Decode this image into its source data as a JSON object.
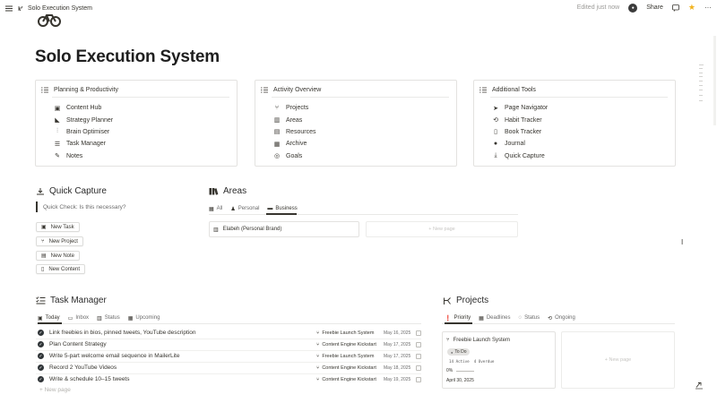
{
  "topbar": {
    "breadcrumb": "Solo Execution System",
    "edited": "Edited just now",
    "share": "Share"
  },
  "page": {
    "title": "Solo Execution System"
  },
  "cards": [
    {
      "title": "Planning & Productivity",
      "items": [
        {
          "label": "Content Hub",
          "icon": "inbox-icon"
        },
        {
          "label": "Strategy Planner",
          "icon": "megaphone-icon"
        },
        {
          "label": "Brain Optimiser",
          "icon": "sliders-icon"
        },
        {
          "label": "Task Manager",
          "icon": "checklist-icon"
        },
        {
          "label": "Notes",
          "icon": "pen-icon"
        }
      ]
    },
    {
      "title": "Activity Overview",
      "items": [
        {
          "label": "Projects",
          "icon": "branch-icon"
        },
        {
          "label": "Areas",
          "icon": "books-icon"
        },
        {
          "label": "Resources",
          "icon": "library-icon"
        },
        {
          "label": "Archive",
          "icon": "archive-icon"
        },
        {
          "label": "Goals",
          "icon": "target-icon"
        }
      ]
    },
    {
      "title": "Additional Tools",
      "items": [
        {
          "label": "Page Navigator",
          "icon": "cursor-icon"
        },
        {
          "label": "Habit Tracker",
          "icon": "repeat-icon"
        },
        {
          "label": "Book Tracker",
          "icon": "book-icon"
        },
        {
          "label": "Journal",
          "icon": "brain-icon"
        },
        {
          "label": "Quick Capture",
          "icon": "download-icon"
        }
      ]
    }
  ],
  "quick_capture": {
    "title": "Quick Capture",
    "check": "Quick Check: Is this necessary?",
    "buttons": [
      "New Task",
      "New Project",
      "New Note",
      "New Content"
    ]
  },
  "areas": {
    "title": "Areas",
    "tabs": [
      "All",
      "Personal",
      "Business"
    ],
    "active_tab": "Business",
    "cards": [
      "Elabeh (Personal Brand)"
    ],
    "new_page": "+ New page"
  },
  "task_manager": {
    "title": "Task Manager",
    "tabs": [
      "Today",
      "Inbox",
      "Status",
      "Upcoming"
    ],
    "active_tab": "Today",
    "tasks": [
      {
        "name": "Link freebies in bios, pinned tweets, YouTube description",
        "project": "Freebie Launch System",
        "date": "May 16, 2025"
      },
      {
        "name": "Plan Content Strategy",
        "project": "Content Engine Kickstart",
        "date": "May 17, 2025"
      },
      {
        "name": "Write 5-part welcome email sequence in MailerLite",
        "project": "Freebie Launch System",
        "date": "May 17, 2025"
      },
      {
        "name": "Record 2 YouTube Videos",
        "project": "Content Engine Kickstart",
        "date": "May 18, 2025"
      },
      {
        "name": "Write & schedule 10–15 tweets",
        "project": "Content Engine Kickstart",
        "date": "May 19, 2025"
      }
    ],
    "new_page": "+ New page"
  },
  "projects": {
    "title": "Projects",
    "tabs": [
      "Priority",
      "Deadlines",
      "Status",
      "Ongoing"
    ],
    "active_tab": "Priority",
    "card": {
      "name": "Freebie Launch System",
      "status": "To Do",
      "active": "14 Active",
      "overdue": "4 Overdue",
      "progress": "0%",
      "date": "April 30, 2025"
    },
    "new_page": "+ New page"
  },
  "colors": {
    "text": "#37352f",
    "muted": "#9b9a97",
    "border": "#e3e2e0",
    "star": "#f2b21b"
  }
}
